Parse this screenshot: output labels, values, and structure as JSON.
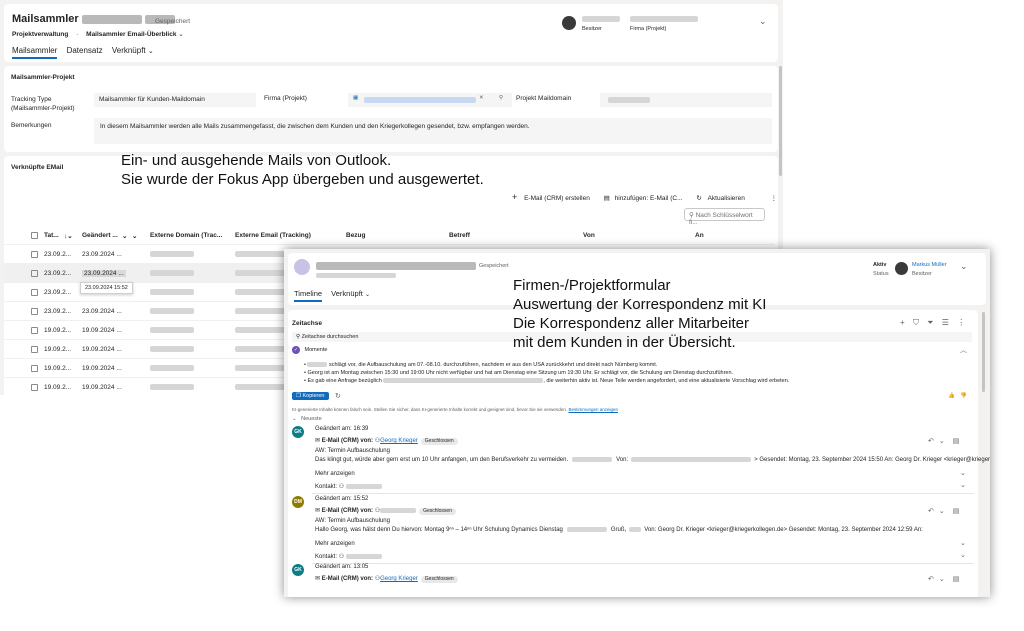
{
  "back": {
    "title": "Mailsammler",
    "saved": "Gespeichert",
    "crumb1": "Projektverwaltung",
    "crumb2": "Mailsammler Email-Überblick",
    "owner_label": "Besitzer",
    "company_label": "Firma (Projekt)",
    "tabs": [
      "Mailsammler",
      "Datensatz",
      "Verknüpft"
    ],
    "section_title": "Mailsammler-Projekt",
    "tracking_label": "Tracking Type (Mailsammler-Projekt)",
    "tracking_value": "Mailsammler für Kunden-Maildomain",
    "firma_label": "Firma (Projekt)",
    "projekt_maildomain_label": "Projekt Maildomain",
    "bemerkungen_label": "Bemerkungen",
    "bemerkungen_value": "In diesem Mailsammler werden alle Mails zusammengefasst, die zwischen dem Kunden und den Kriegerkollegen gesendet, bzw. empfangen werden.",
    "linked_title": "Verknüpfte EMail",
    "cmd_email": "E-Mail (CRM) erstellen",
    "cmd_add": "hinzufügen: E-Mail (C...",
    "cmd_refresh": "Aktualisieren",
    "search_placeholder": "Nach Schlüsselwort fi...",
    "columns": [
      "Tat...",
      "Geändert ...",
      "Externe Domain (Trac...",
      "Externe Email (Tracking)",
      "Bezug",
      "Betreff",
      "Von",
      "An"
    ],
    "rows": [
      {
        "tat": "23.09.2...",
        "geaendert": "23.09.2024 ..."
      },
      {
        "tat": "23.09.2...",
        "geaendert": "23.09.2024 ..."
      },
      {
        "tat": "23.09.2...",
        "geaendert": "23.09.2024 15:52"
      },
      {
        "tat": "23.09.2...",
        "geaendert": "23.09.2024 ..."
      },
      {
        "tat": "19.09.2...",
        "geaendert": "19.09.2024 ..."
      },
      {
        "tat": "19.09.2...",
        "geaendert": "19.09.2024 ..."
      },
      {
        "tat": "19.09.2...",
        "geaendert": "19.09.2024 ..."
      },
      {
        "tat": "19.09.2...",
        "geaendert": "19.09.2024 ..."
      }
    ]
  },
  "annotation1": {
    "line1": "Ein- und ausgehende Mails von Outlook.",
    "line2": "Sie wurde der Fokus App übergeben und ausgewertet."
  },
  "annotation2": {
    "line1": "Firmen-/Projektformular",
    "line2": "Auswertung der Korrespondenz mit KI",
    "line3": "Die Korrespondenz aller Mitarbeiter",
    "line4": "mit dem Kunden in der Übersicht."
  },
  "front": {
    "saved": "Gespeichert",
    "status_value": "Aktiv",
    "status_label": "Status",
    "owner_name": "Markus Müller",
    "owner_label": "Besitzer",
    "tabs": [
      "Timeline",
      "Verknüpft"
    ],
    "zeitachse": "Zeitachse",
    "search_placeholder": "Zeitachse durchsuchen",
    "momente": "Momente",
    "bullets": [
      "schlägt vor, die Aufbauschulung am 07.-08.10. durchzuführen, nachdem er aus den USA zurückkehrt und direkt nach Nürnberg kommt.",
      "Georg ist am Montag zwischen 15:30 und 19:00 Uhr nicht verfügbar und hat am Dienstag eine Sitzung um 19:30 Uhr. Er schlägt vor, die Schulung am Dienstag durchzuführen.",
      "Es gab eine Anfrage bezüglich",
      ", die weiterhin aktiv ist. Neue Teile werden angefordert, und eine aktualisierte Vorschlag wird erbeten."
    ],
    "copy_label": "Kopieren",
    "ai_notice": "KI-generierte Inhalte können falsch sein. Stellen Sie sicher, dass KI-generierte Inhalte korrekt und geeignet sind, bevor Sie sie verwenden.",
    "ai_link": "Bestimmungen anzeigen",
    "neueste": "Neueste",
    "entries": [
      {
        "initials": "GK",
        "color": "#0e7c86",
        "changed": "Geändert am: 16:39",
        "type": "E-Mail (CRM) von:",
        "sender": "Georg Krieger",
        "status": "Geschlossen",
        "subject": "AW: Termin Aufbauschulung",
        "body": "Das klingt gut, würde aber gern erst um 10 Uhr anfangen, um den Berufsverkehr zu vermeiden.",
        "body2_prefix": "Von:",
        "body2_suffix": "> Gesendet: Montag, 23. September 2024 15:50 An: Georg Dr. Krieger <krieger@kriegerkollegen...",
        "more": "Mehr anzeigen",
        "contact": "Kontakt:"
      },
      {
        "initials": "DM",
        "color": "#8f7b00",
        "changed": "Geändert am: 15:52",
        "type": "E-Mail (CRM) von:",
        "sender": "",
        "status": "Geschlossen",
        "subject": "AW: Termin Aufbauschulung",
        "body": "Hallo Georg, was hälst denn Du hiervon:  Montag 9ⁿⁿ – 14ⁿⁿ Uhr Schulung Dynamics Dienstag",
        "body2_prefix": "Gruß,",
        "body2_suffix": "Von: Georg Dr. Krieger <krieger@kriegerkollegen.de> Gesendet: Montag, 23. September 2024 12:59 An:",
        "more": "Mehr anzeigen",
        "contact": "Kontakt:"
      },
      {
        "initials": "GK",
        "color": "#0e7c86",
        "changed": "Geändert am: 13:05",
        "type": "E-Mail (CRM) von:",
        "sender": "Georg Krieger",
        "status": "Geschlossen"
      }
    ]
  }
}
